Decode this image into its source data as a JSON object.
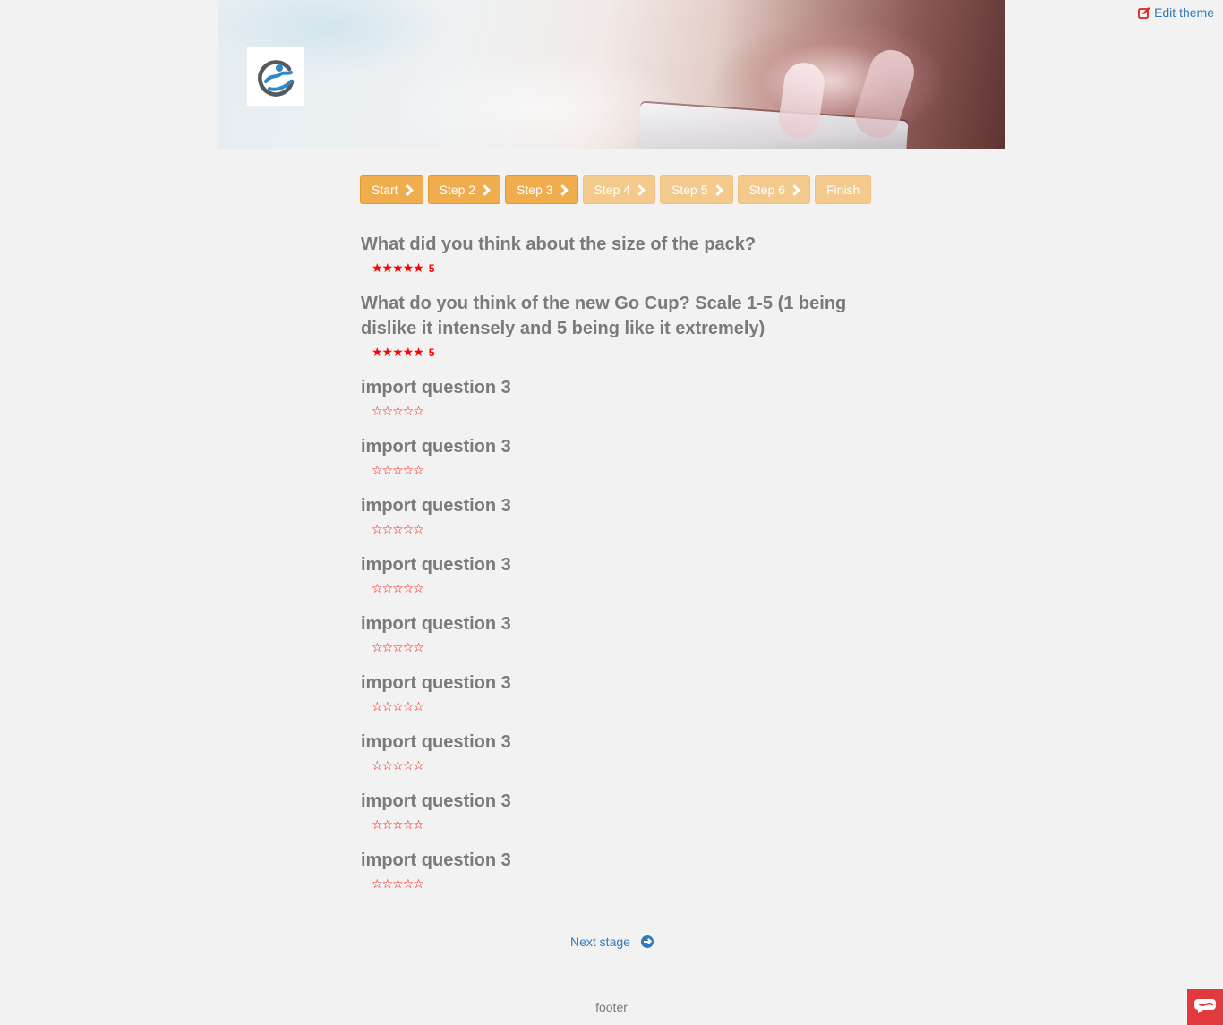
{
  "header": {
    "edit_theme_label": "Edit theme"
  },
  "progress": {
    "steps": [
      {
        "label": "Start",
        "state": "done"
      },
      {
        "label": "Step 2",
        "state": "done"
      },
      {
        "label": "Step 3",
        "state": "current"
      },
      {
        "label": "Step 4",
        "state": "disabled"
      },
      {
        "label": "Step 5",
        "state": "disabled"
      },
      {
        "label": "Step 6",
        "state": "disabled"
      },
      {
        "label": "Finish",
        "state": "disabled"
      }
    ]
  },
  "questions": [
    {
      "title": "What did you think about the size of the pack?",
      "stars": "★★★★★",
      "rating": 5,
      "value": "5"
    },
    {
      "title": "What do you think of the new Go Cup? Scale 1-5 (1 being dislike it intensely and 5 being like it extremely)",
      "stars": "★★★★★",
      "rating": 5,
      "value": "5"
    },
    {
      "title": "import question 3",
      "stars": "☆☆☆☆☆",
      "rating": 0,
      "value": ""
    },
    {
      "title": "import question 3",
      "stars": "☆☆☆☆☆",
      "rating": 0,
      "value": ""
    },
    {
      "title": "import question 3",
      "stars": "☆☆☆☆☆",
      "rating": 0,
      "value": ""
    },
    {
      "title": "import question 3",
      "stars": "☆☆☆☆☆",
      "rating": 0,
      "value": ""
    },
    {
      "title": "import question 3",
      "stars": "☆☆☆☆☆",
      "rating": 0,
      "value": ""
    },
    {
      "title": "import question 3",
      "stars": "☆☆☆☆☆",
      "rating": 0,
      "value": ""
    },
    {
      "title": "import question 3",
      "stars": "☆☆☆☆☆",
      "rating": 0,
      "value": ""
    },
    {
      "title": "import question 3",
      "stars": "☆☆☆☆☆",
      "rating": 0,
      "value": ""
    },
    {
      "title": "import question 3",
      "stars": "☆☆☆☆☆",
      "rating": 0,
      "value": ""
    }
  ],
  "navigation": {
    "next_label": "Next stage"
  },
  "footer": {
    "text": "footer"
  },
  "colors": {
    "step_active": "#f0ad4e",
    "step_disabled": "#f4c98c",
    "star": "#ff0000",
    "link": "#337ab7",
    "widget": "#e03a3e"
  },
  "icons": {
    "edit": "edit-icon",
    "chevron": "chevron-right-icon",
    "next": "arrow-circle-right-icon",
    "widget": "chat-widget-icon",
    "logo": "company-logo"
  }
}
